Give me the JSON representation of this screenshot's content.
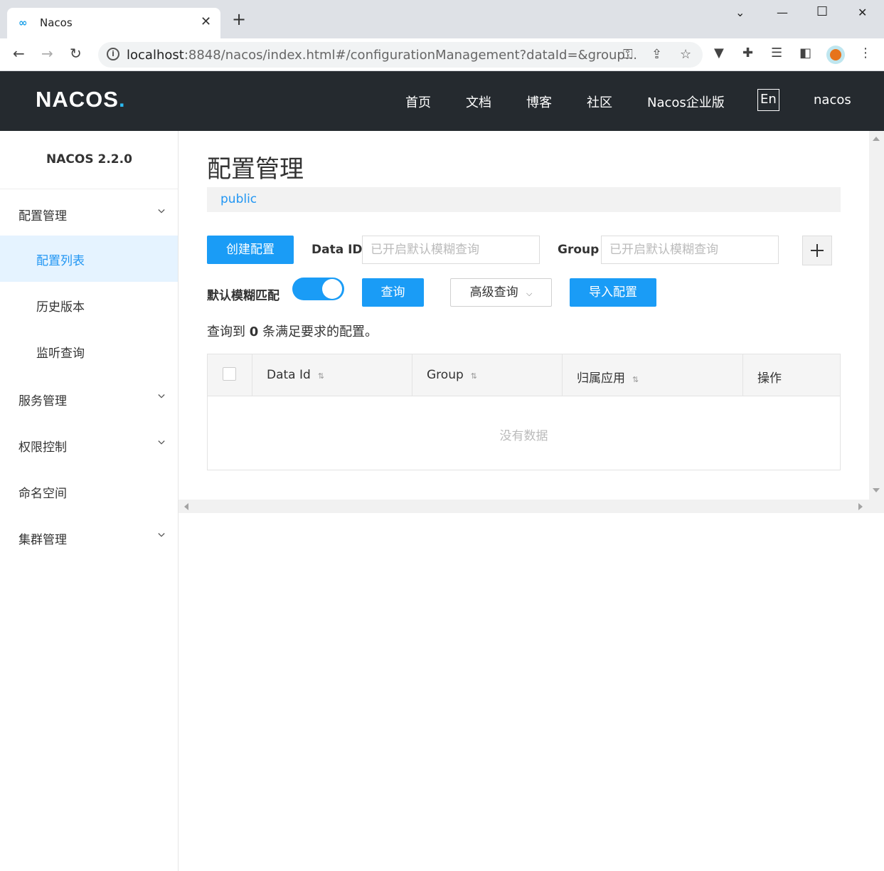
{
  "browser": {
    "tab_title": "Nacos",
    "tab_favicon": "nacos-infinity-icon",
    "new_tab": "+",
    "url_host": "localhost",
    "url_rest": ":8848/nacos/index.html#/configurationManagement?dataId=&group...",
    "window_controls": [
      "chevron-down-icon",
      "minimize-icon",
      "maximize-icon",
      "close-icon"
    ]
  },
  "header": {
    "logo_main": "NACOS",
    "logo_dot": ".",
    "nav": [
      "首页",
      "文档",
      "博客",
      "社区",
      "Nacos企业版"
    ],
    "lang": "En",
    "user": "nacos"
  },
  "sidebar": {
    "version": "NACOS 2.2.0",
    "items": [
      {
        "label": "配置管理",
        "expandable": true
      },
      {
        "label": "配置列表",
        "active": true
      },
      {
        "label": "历史版本"
      },
      {
        "label": "监听查询"
      },
      {
        "label": "服务管理",
        "expandable": true
      },
      {
        "label": "权限控制",
        "expandable": true
      },
      {
        "label": "命名空间"
      },
      {
        "label": "集群管理",
        "expandable": true
      }
    ]
  },
  "main": {
    "title": "配置管理",
    "namespace": "public",
    "create_button": "创建配置",
    "data_id_label": "Data ID",
    "data_id_placeholder": "已开启默认模糊查询",
    "group_label": "Group",
    "group_placeholder": "已开启默认模糊查询",
    "fuzzy_label": "默认模糊匹配",
    "fuzzy_enabled": true,
    "query_button": "查询",
    "advanced_button": "高级查询",
    "import_button": "导入配置",
    "result_prefix": "查询到",
    "result_count": "0",
    "result_suffix": "条满足要求的配置。",
    "table": {
      "columns": [
        "Data Id",
        "Group",
        "归属应用",
        "操作"
      ],
      "empty_text": "没有数据"
    }
  },
  "colors": {
    "primary": "#1a9cf6",
    "header_bg": "#252a2f",
    "active_bg": "#e5f3ff"
  }
}
